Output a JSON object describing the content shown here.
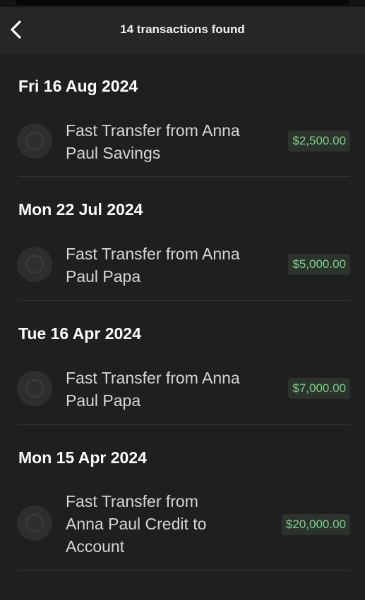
{
  "header": {
    "back_icon": "chevron-left-icon",
    "title": "14 transactions found"
  },
  "sections": [
    {
      "date": "Fri 16 Aug 2024",
      "transactions": [
        {
          "icon": "placeholder-avatar-icon",
          "description": "Fast Transfer from Anna Paul Savings",
          "amount": "$2,500.00"
        }
      ]
    },
    {
      "date": "Mon 22 Jul 2024",
      "transactions": [
        {
          "icon": "placeholder-avatar-icon",
          "description": "Fast Transfer from Anna Paul Papa",
          "amount": "$5,000.00"
        }
      ]
    },
    {
      "date": "Tue 16 Apr 2024",
      "transactions": [
        {
          "icon": "placeholder-avatar-icon",
          "description": "Fast Transfer from Anna Paul Papa",
          "amount": "$7,000.00"
        }
      ]
    },
    {
      "date": "Mon 15 Apr 2024",
      "transactions": [
        {
          "icon": "placeholder-avatar-icon",
          "description": "Fast Transfer from Anna Paul Credit to Account",
          "amount": "$20,000.00"
        }
      ]
    }
  ],
  "colors": {
    "background": "#1f1f1f",
    "header": "#262626",
    "amount_text": "#7fd08b",
    "amount_bg": "#2b332c"
  }
}
